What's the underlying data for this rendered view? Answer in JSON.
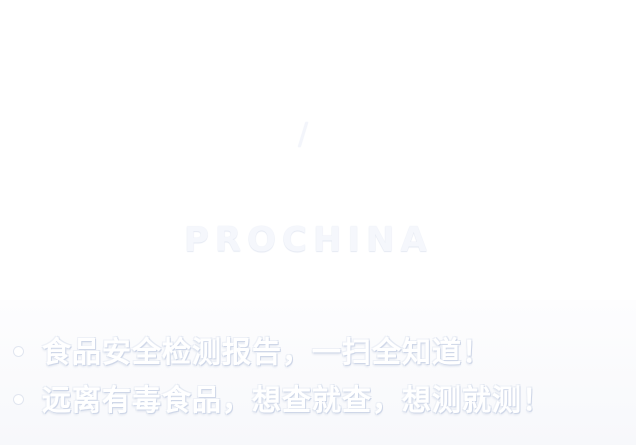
{
  "header": {
    "accent_glyph": "/",
    "brand_name": "PROCHINA"
  },
  "features": [
    {
      "text": "食品安全检测报告，一扫全知道！"
    },
    {
      "text": "远离有毒食品，想查就查，想测就测！"
    }
  ],
  "colors": {
    "background": "#ffffff",
    "text_fill": "#ffffff",
    "text_outline": "#cfd7e8"
  }
}
